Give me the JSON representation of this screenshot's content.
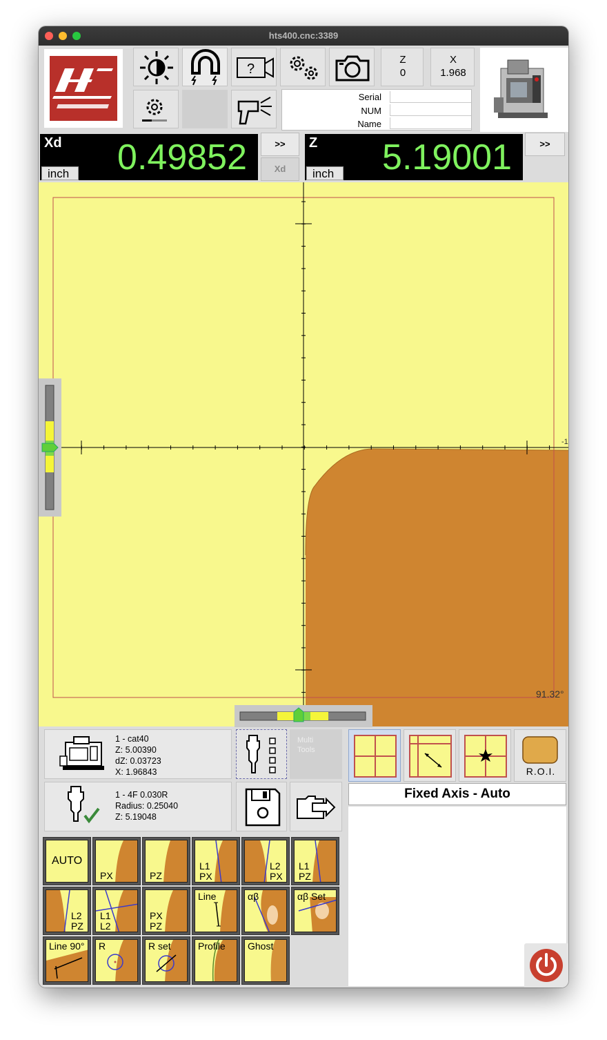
{
  "window": {
    "title": "hts400.cnc:3389"
  },
  "header": {
    "z_label": "Z",
    "z_value": "0",
    "x_label": "X",
    "x_value": "1.968",
    "serial_label": "Serial",
    "num_label": "NUM",
    "name_label": "Name",
    "serial_value": "",
    "num_value": "",
    "name_value": ""
  },
  "dro": [
    {
      "axis": "Xd",
      "value": "0.49852",
      "unit": "inch",
      "expand": ">>"
    },
    {
      "axis": "Z",
      "value": "5.19001",
      "unit": "inch",
      "expand": ">>"
    }
  ],
  "xd_button": "Xd",
  "viewport": {
    "angle_readout": "91.32°",
    "axis_end_label": "-1",
    "background_color": "#f8f88d",
    "part_color": "#cf8530",
    "roi_color": "#c0504d"
  },
  "machine_info": {
    "lines": [
      "1 - cat40",
      "Z: 5.00390",
      "dZ: 0.03723",
      "X: 1.96843"
    ]
  },
  "tool_info": {
    "lines": [
      "1 - 4F 0.030R",
      "Radius: 0.25040",
      "Z: 5.19048"
    ]
  },
  "multi_tools_label": "Multi Tools",
  "mode_buttons": {
    "roi_label": "R.O.I."
  },
  "status_text": "Fixed Axis - Auto",
  "tools": [
    {
      "id": "auto",
      "label": "AUTO"
    },
    {
      "id": "px",
      "label": "PX"
    },
    {
      "id": "pz",
      "label": "PZ"
    },
    {
      "id": "l1px",
      "label": "L1\nPX"
    },
    {
      "id": "l2px",
      "label": "L2\nPX"
    },
    {
      "id": "l1pz",
      "label": "L1\nPZ"
    },
    {
      "id": "l2pz",
      "label": "L2\nPZ"
    },
    {
      "id": "l1l2",
      "label": "L1\nL2"
    },
    {
      "id": "pxpz",
      "label": "PX\nPZ"
    },
    {
      "id": "line",
      "label": "Line"
    },
    {
      "id": "ab",
      "label": "αβ"
    },
    {
      "id": "abset",
      "label": "αβ Set"
    },
    {
      "id": "line90",
      "label": "Line 90°"
    },
    {
      "id": "r",
      "label": "R"
    },
    {
      "id": "rset",
      "label": "R set"
    },
    {
      "id": "profile",
      "label": "Profile"
    },
    {
      "id": "ghost",
      "label": "Ghost"
    }
  ],
  "icons": {
    "brightness": "brightness-icon",
    "magnet": "magnet-icon",
    "help_camera": "help-camera-icon",
    "settings": "gears-icon",
    "camera": "camera-icon",
    "config": "settings-slider-icon",
    "light_gun": "light-gun-icon",
    "printer": "printer-icon",
    "power": "power-icon"
  }
}
